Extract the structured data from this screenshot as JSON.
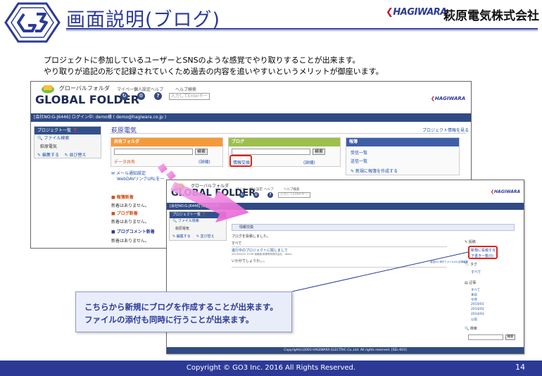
{
  "slide": {
    "title": "画面説明(ブログ)",
    "company_logo": "HAGIWARA",
    "company_name": "萩原電気株式会社",
    "description_lines": [
      "プロジェクトに参加しているユーザーとSNSのような感覚でやり取りすることが出来ます。",
      "やり取りが追記の形で記録されていくため過去の内容を追いやすいというメリットが御座います。"
    ],
    "callout_lines": [
      "こちらから新規にブログを作成することが出来ます。",
      "ファイルの添付も同時に行うことが出来ます。"
    ],
    "copyright": "Copyright © GO3 Inc. 2016  All Rights Reserved.",
    "page_number": "14",
    "colors": {
      "brand_navy": "#2c3a96",
      "highlight_red": "#e0231d",
      "arrow_pink": "#f06bd8"
    }
  },
  "app_a": {
    "brand_jp": "グローバルフォルダ",
    "brand_en": "GLOBAL FOLDER",
    "nav": [
      "マイページ",
      "個人設定",
      "ヘルプ"
    ],
    "search_label": "ヘルプ検索",
    "search_placeholder": "入力してEnterキー",
    "logo": "HAGIWARA",
    "login_bar": "[会社NO:G-J6446] ログイン中: demo様 ( demo@hagiwara.co.jp )",
    "left_panel": {
      "header": "プロジェクト一覧",
      "search_link": "ファイル検索",
      "company": "萩原電気",
      "actions": [
        "編集する",
        "並び替え"
      ]
    },
    "org_name": "萩原電気",
    "project_settings_link": "プロジェクト情報を見る",
    "shared_folder": {
      "header": "共有フォルダ",
      "search_button": "検索",
      "label": "データ共有",
      "detail": "(詳細)",
      "mail_notify": "メール通知設定",
      "webdav": "WebDAVリンクURLを一"
    },
    "blog": {
      "header": "ブログ",
      "search_button": "検索",
      "entry": "情報交換",
      "detail": "(詳細)"
    },
    "board": {
      "header": "報簿",
      "items": [
        "受信一覧",
        "送信一覧"
      ],
      "new_link": "新規に報簿を作成する"
    },
    "updates": {
      "news_header": "報簿新着",
      "news_empty": "新着はありません。",
      "blog_header": "ブログ新着",
      "blog_empty": "新着はありません。",
      "comment_header": "ブログコメント新着",
      "comment_empty": "新着はありません。"
    }
  },
  "app_b": {
    "brand_jp": "グローバルフォルダ",
    "brand_en": "GLOBAL FOLDER",
    "nav": [
      "マイページ",
      "個人設定",
      "ヘルプ"
    ],
    "search_label": "ヘルプ検索",
    "search_placeholder": "入力してEnterキー",
    "logo": "HAGIWARA",
    "login_bar": "[会社NO:G-J6446] ログイン中",
    "left_panel": {
      "header": "プロジェクト一覧",
      "search_link": "ファイル検索",
      "company": "萩原電気",
      "actions": [
        "編集する",
        "並び替え"
      ]
    },
    "blog_title": "情報交換",
    "blog_intro": "ブログを投稿しました。",
    "filter_label": "すべて",
    "post_title": "進行中のプロジェクトに関しまして",
    "post_meta": "2014/04/02 10:56 投稿者:萩原電気株式会社 - demo",
    "post_body": "いかがでしょうか。。。",
    "post_footer_link": "返信(0) 添付ファイル(0) 記事編集",
    "sidebar": {
      "post_header": "投稿",
      "create_link": "新規に投稿する",
      "drafts_link": "下書き一覧(0)",
      "tag_header": "タグ",
      "tag_all": "すべて",
      "articles_header": "記事",
      "article_links": [
        "すべて",
        "本日",
        "今月",
        "2014/01",
        "2014/02",
        "2014/03",
        "以前"
      ],
      "search_header": "検索",
      "search_button": "検索"
    },
    "footer": "Copyright(c)2003 HAGIWARA ELECTRIC Co.,Ltd. All rights reserved. [SEL-003]"
  }
}
